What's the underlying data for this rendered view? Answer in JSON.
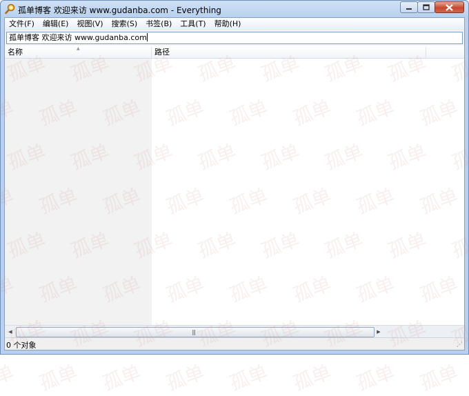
{
  "window": {
    "title": "孤单博客 欢迎来访 www.gudanba.com - Everything",
    "controls": [
      "minimize",
      "maximize",
      "close"
    ]
  },
  "menu": [
    "文件(F)",
    "编辑(E)",
    "视图(V)",
    "搜索(S)",
    "书签(B)",
    "工具(T)",
    "帮助(H)"
  ],
  "search": {
    "value": "孤单博客 欢迎来访 www.gudanba.com"
  },
  "columns": [
    "名称",
    "路径"
  ],
  "status": {
    "text": "0 个对象"
  },
  "watermark": {
    "text": "孤单"
  },
  "colors": {
    "titlebar": "#b9d1ee",
    "name_column_bg": "#f2f2f2",
    "close_button": "#c6492f"
  },
  "icons": [
    "everything-search-icon",
    "minimize-icon",
    "maximize-icon",
    "close-icon"
  ]
}
